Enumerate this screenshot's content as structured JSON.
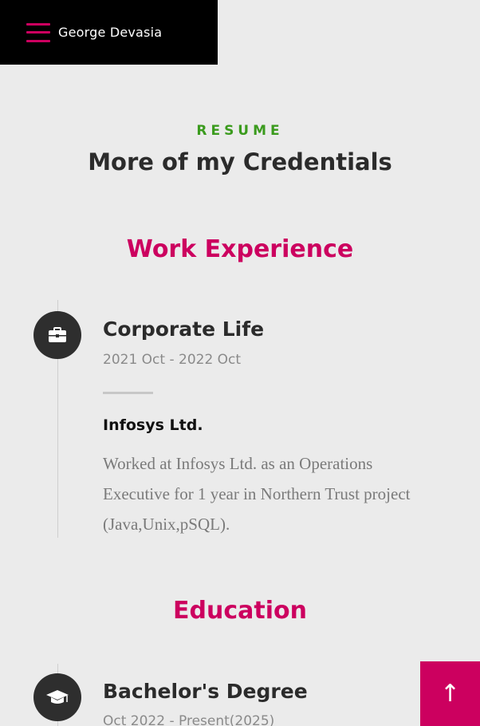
{
  "header": {
    "site_name": "George Devasia",
    "menu_icon": "hamburger-icon",
    "accent_color": "#cc005f"
  },
  "resume": {
    "kicker": "RESUME",
    "title": "More of my Credentials",
    "kicker_color": "#3b9b1e"
  },
  "work": {
    "heading": "Work Experience",
    "entries": [
      {
        "icon": "briefcase-icon",
        "title": "Corporate Life",
        "date": "2021 Oct - 2022 Oct",
        "company": "Infosys Ltd.",
        "description": "Worked at Infosys Ltd. as an Operations Executive for 1 year in Northern Trust project (Java,Unix,pSQL)."
      }
    ]
  },
  "education": {
    "heading": "Education",
    "entries": [
      {
        "icon": "graduation-cap-icon",
        "title": "Bachelor's Degree",
        "date": "Oct 2022 - Present(2025)"
      }
    ]
  },
  "back_to_top": {
    "icon": "arrow-up-icon",
    "glyph": "↑"
  }
}
